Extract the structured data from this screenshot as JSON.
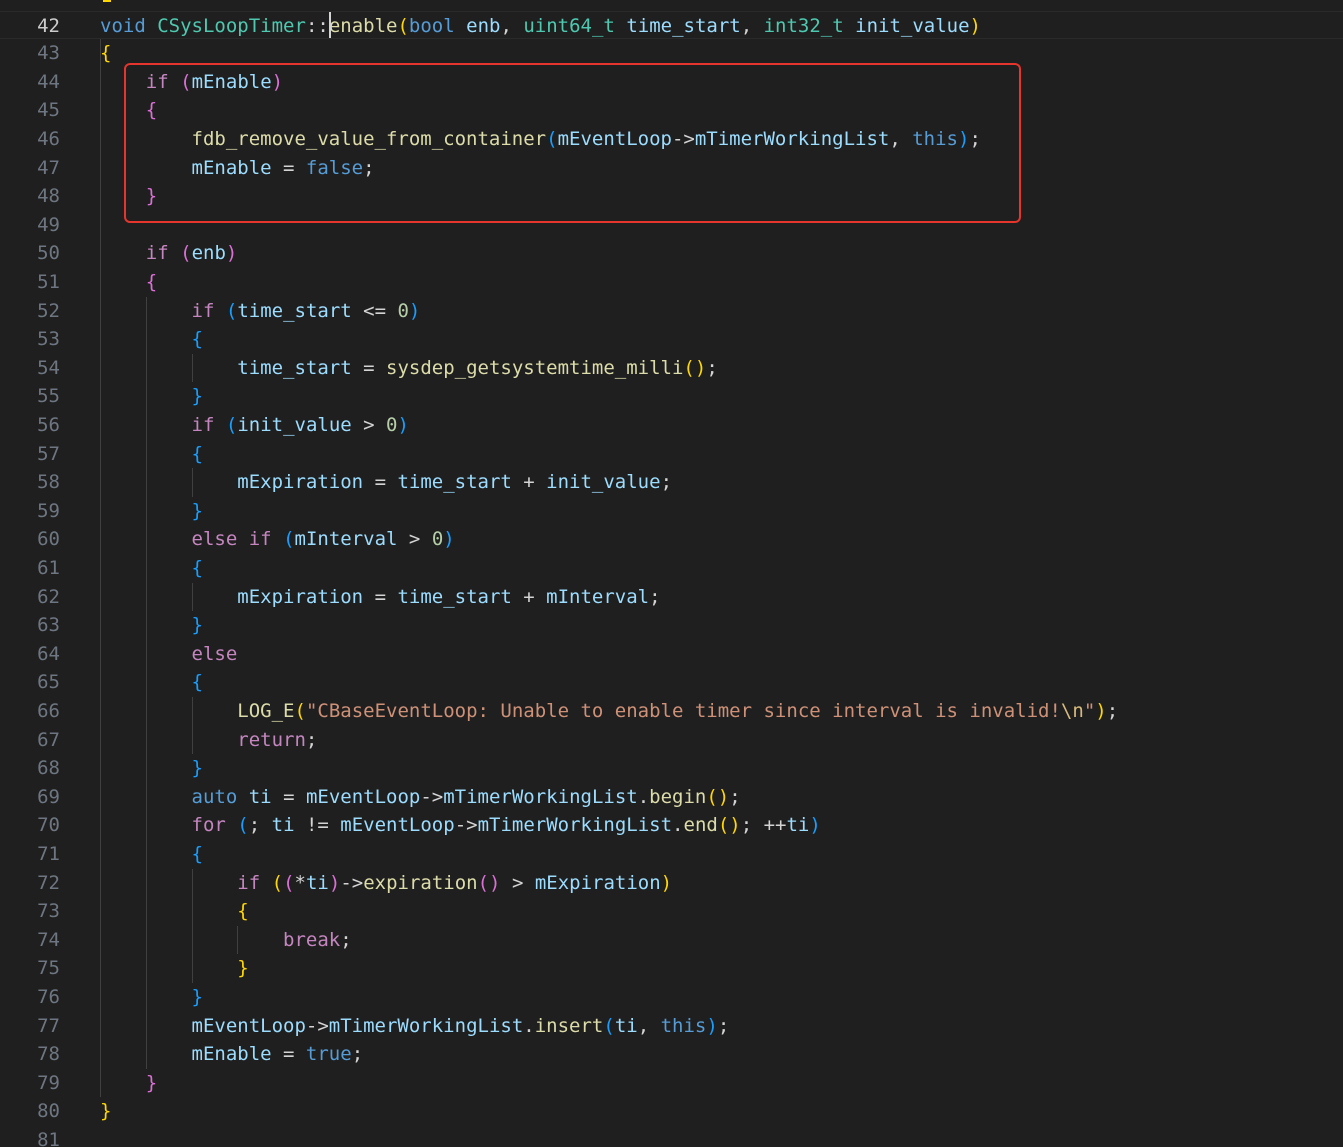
{
  "editor": {
    "theme_colors": {
      "background": "#1f1f1f",
      "line_number": "#6e7681",
      "active_line_number": "#cccccc",
      "keyword_blue": "#569cd6",
      "control_purple": "#c586c0",
      "type_teal": "#4ec9b0",
      "function_yellow": "#dcdcaa",
      "variable_blue": "#9cdcfe",
      "string_orange": "#ce9178",
      "number_green": "#b5cea8",
      "bracket_gold": "#ffd700",
      "bracket_pink": "#da70d6",
      "bracket_blue": "#179fff",
      "highlight_box": "#e5352c"
    },
    "current_line": 42,
    "lines": [
      {
        "n": "42",
        "tokens": [
          [
            "kw",
            "void"
          ],
          [
            "p",
            " "
          ],
          [
            "ty",
            "CSysLoopTimer"
          ],
          [
            "p",
            "::"
          ],
          [
            "fn",
            "enable"
          ],
          [
            "b1",
            "("
          ],
          [
            "kw",
            "bool"
          ],
          [
            "p",
            " "
          ],
          [
            "var",
            "enb"
          ],
          [
            "p",
            ", "
          ],
          [
            "ty",
            "uint64_t"
          ],
          [
            "p",
            " "
          ],
          [
            "var",
            "time_start"
          ],
          [
            "p",
            ", "
          ],
          [
            "ty",
            "int32_t"
          ],
          [
            "p",
            " "
          ],
          [
            "var",
            "init_value"
          ],
          [
            "b1",
            ")"
          ]
        ]
      },
      {
        "n": "43",
        "tokens": [
          [
            "b1",
            "{"
          ]
        ]
      },
      {
        "n": "44",
        "tokens": [
          [
            "p",
            "    "
          ],
          [
            "ctl",
            "if"
          ],
          [
            "p",
            " "
          ],
          [
            "b2",
            "("
          ],
          [
            "var",
            "mEnable"
          ],
          [
            "b2",
            ")"
          ]
        ]
      },
      {
        "n": "45",
        "tokens": [
          [
            "p",
            "    "
          ],
          [
            "b2",
            "{"
          ]
        ]
      },
      {
        "n": "46",
        "tokens": [
          [
            "p",
            "        "
          ],
          [
            "fn",
            "fdb_remove_value_from_container"
          ],
          [
            "b3",
            "("
          ],
          [
            "var",
            "mEventLoop"
          ],
          [
            "p",
            "->"
          ],
          [
            "var",
            "mTimerWorkingList"
          ],
          [
            "p",
            ", "
          ],
          [
            "kw",
            "this"
          ],
          [
            "b3",
            ")"
          ],
          [
            "p",
            ";"
          ]
        ]
      },
      {
        "n": "47",
        "tokens": [
          [
            "p",
            "        "
          ],
          [
            "var",
            "mEnable"
          ],
          [
            "p",
            " = "
          ],
          [
            "kw",
            "false"
          ],
          [
            "p",
            ";"
          ]
        ]
      },
      {
        "n": "48",
        "tokens": [
          [
            "p",
            "    "
          ],
          [
            "b2",
            "}"
          ]
        ]
      },
      {
        "n": "49",
        "tokens": []
      },
      {
        "n": "50",
        "tokens": [
          [
            "p",
            "    "
          ],
          [
            "ctl",
            "if"
          ],
          [
            "p",
            " "
          ],
          [
            "b2",
            "("
          ],
          [
            "var",
            "enb"
          ],
          [
            "b2",
            ")"
          ]
        ]
      },
      {
        "n": "51",
        "tokens": [
          [
            "p",
            "    "
          ],
          [
            "b2",
            "{"
          ]
        ]
      },
      {
        "n": "52",
        "tokens": [
          [
            "p",
            "        "
          ],
          [
            "ctl",
            "if"
          ],
          [
            "p",
            " "
          ],
          [
            "b3",
            "("
          ],
          [
            "var",
            "time_start"
          ],
          [
            "p",
            " <= "
          ],
          [
            "num",
            "0"
          ],
          [
            "b3",
            ")"
          ]
        ]
      },
      {
        "n": "53",
        "tokens": [
          [
            "p",
            "        "
          ],
          [
            "b3",
            "{"
          ]
        ]
      },
      {
        "n": "54",
        "tokens": [
          [
            "p",
            "            "
          ],
          [
            "var",
            "time_start"
          ],
          [
            "p",
            " = "
          ],
          [
            "fn",
            "sysdep_getsystemtime_milli"
          ],
          [
            "b1",
            "()"
          ],
          [
            "p",
            ";"
          ]
        ]
      },
      {
        "n": "55",
        "tokens": [
          [
            "p",
            "        "
          ],
          [
            "b3",
            "}"
          ]
        ]
      },
      {
        "n": "56",
        "tokens": [
          [
            "p",
            "        "
          ],
          [
            "ctl",
            "if"
          ],
          [
            "p",
            " "
          ],
          [
            "b3",
            "("
          ],
          [
            "var",
            "init_value"
          ],
          [
            "p",
            " > "
          ],
          [
            "num",
            "0"
          ],
          [
            "b3",
            ")"
          ]
        ]
      },
      {
        "n": "57",
        "tokens": [
          [
            "p",
            "        "
          ],
          [
            "b3",
            "{"
          ]
        ]
      },
      {
        "n": "58",
        "tokens": [
          [
            "p",
            "            "
          ],
          [
            "var",
            "mExpiration"
          ],
          [
            "p",
            " = "
          ],
          [
            "var",
            "time_start"
          ],
          [
            "p",
            " + "
          ],
          [
            "var",
            "init_value"
          ],
          [
            "p",
            ";"
          ]
        ]
      },
      {
        "n": "59",
        "tokens": [
          [
            "p",
            "        "
          ],
          [
            "b3",
            "}"
          ]
        ]
      },
      {
        "n": "60",
        "tokens": [
          [
            "p",
            "        "
          ],
          [
            "ctl",
            "else"
          ],
          [
            "p",
            " "
          ],
          [
            "ctl",
            "if"
          ],
          [
            "p",
            " "
          ],
          [
            "b3",
            "("
          ],
          [
            "var",
            "mInterval"
          ],
          [
            "p",
            " > "
          ],
          [
            "num",
            "0"
          ],
          [
            "b3",
            ")"
          ]
        ]
      },
      {
        "n": "61",
        "tokens": [
          [
            "p",
            "        "
          ],
          [
            "b3",
            "{"
          ]
        ]
      },
      {
        "n": "62",
        "tokens": [
          [
            "p",
            "            "
          ],
          [
            "var",
            "mExpiration"
          ],
          [
            "p",
            " = "
          ],
          [
            "var",
            "time_start"
          ],
          [
            "p",
            " + "
          ],
          [
            "var",
            "mInterval"
          ],
          [
            "p",
            ";"
          ]
        ]
      },
      {
        "n": "63",
        "tokens": [
          [
            "p",
            "        "
          ],
          [
            "b3",
            "}"
          ]
        ]
      },
      {
        "n": "64",
        "tokens": [
          [
            "p",
            "        "
          ],
          [
            "ctl",
            "else"
          ]
        ]
      },
      {
        "n": "65",
        "tokens": [
          [
            "p",
            "        "
          ],
          [
            "b3",
            "{"
          ]
        ]
      },
      {
        "n": "66",
        "tokens": [
          [
            "p",
            "            "
          ],
          [
            "fn",
            "LOG_E"
          ],
          [
            "b1",
            "("
          ],
          [
            "str",
            "\"CBaseEventLoop: Unable to enable timer since interval is invalid!"
          ],
          [
            "esc",
            "\\n"
          ],
          [
            "str",
            "\""
          ],
          [
            "b1",
            ")"
          ],
          [
            "p",
            ";"
          ]
        ]
      },
      {
        "n": "67",
        "tokens": [
          [
            "p",
            "            "
          ],
          [
            "ctl",
            "return"
          ],
          [
            "p",
            ";"
          ]
        ]
      },
      {
        "n": "68",
        "tokens": [
          [
            "p",
            "        "
          ],
          [
            "b3",
            "}"
          ]
        ]
      },
      {
        "n": "69",
        "tokens": [
          [
            "p",
            "        "
          ],
          [
            "kw",
            "auto"
          ],
          [
            "p",
            " "
          ],
          [
            "var",
            "ti"
          ],
          [
            "p",
            " = "
          ],
          [
            "var",
            "mEventLoop"
          ],
          [
            "p",
            "->"
          ],
          [
            "var",
            "mTimerWorkingList"
          ],
          [
            "p",
            "."
          ],
          [
            "fn",
            "begin"
          ],
          [
            "b1",
            "()"
          ],
          [
            "p",
            ";"
          ]
        ]
      },
      {
        "n": "70",
        "tokens": [
          [
            "p",
            "        "
          ],
          [
            "ctl",
            "for"
          ],
          [
            "p",
            " "
          ],
          [
            "b3",
            "("
          ],
          [
            "p",
            "; "
          ],
          [
            "var",
            "ti"
          ],
          [
            "p",
            " != "
          ],
          [
            "var",
            "mEventLoop"
          ],
          [
            "p",
            "->"
          ],
          [
            "var",
            "mTimerWorkingList"
          ],
          [
            "p",
            "."
          ],
          [
            "fn",
            "end"
          ],
          [
            "b1",
            "()"
          ],
          [
            "p",
            "; ++"
          ],
          [
            "var",
            "ti"
          ],
          [
            "b3",
            ")"
          ]
        ]
      },
      {
        "n": "71",
        "tokens": [
          [
            "p",
            "        "
          ],
          [
            "b3",
            "{"
          ]
        ]
      },
      {
        "n": "72",
        "tokens": [
          [
            "p",
            "            "
          ],
          [
            "ctl",
            "if"
          ],
          [
            "p",
            " "
          ],
          [
            "b1",
            "("
          ],
          [
            "b2",
            "("
          ],
          [
            "p",
            "*"
          ],
          [
            "var",
            "ti"
          ],
          [
            "b2",
            ")"
          ],
          [
            "p",
            "->"
          ],
          [
            "fn",
            "expiration"
          ],
          [
            "b2",
            "()"
          ],
          [
            "p",
            " > "
          ],
          [
            "var",
            "mExpiration"
          ],
          [
            "b1",
            ")"
          ]
        ]
      },
      {
        "n": "73",
        "tokens": [
          [
            "p",
            "            "
          ],
          [
            "b1",
            "{"
          ]
        ]
      },
      {
        "n": "74",
        "tokens": [
          [
            "p",
            "                "
          ],
          [
            "ctl",
            "break"
          ],
          [
            "p",
            ";"
          ]
        ]
      },
      {
        "n": "75",
        "tokens": [
          [
            "p",
            "            "
          ],
          [
            "b1",
            "}"
          ]
        ]
      },
      {
        "n": "76",
        "tokens": [
          [
            "p",
            "        "
          ],
          [
            "b3",
            "}"
          ]
        ]
      },
      {
        "n": "77",
        "tokens": [
          [
            "p",
            "        "
          ],
          [
            "var",
            "mEventLoop"
          ],
          [
            "p",
            "->"
          ],
          [
            "var",
            "mTimerWorkingList"
          ],
          [
            "p",
            "."
          ],
          [
            "fn",
            "insert"
          ],
          [
            "b3",
            "("
          ],
          [
            "var",
            "ti"
          ],
          [
            "p",
            ", "
          ],
          [
            "kw",
            "this"
          ],
          [
            "b3",
            ")"
          ],
          [
            "p",
            ";"
          ]
        ]
      },
      {
        "n": "78",
        "tokens": [
          [
            "p",
            "        "
          ],
          [
            "var",
            "mEnable"
          ],
          [
            "p",
            " = "
          ],
          [
            "kw",
            "true"
          ],
          [
            "p",
            ";"
          ]
        ]
      },
      {
        "n": "79",
        "tokens": [
          [
            "p",
            "    "
          ],
          [
            "b2",
            "}"
          ]
        ]
      },
      {
        "n": "80",
        "tokens": [
          [
            "b1",
            "}"
          ]
        ]
      },
      {
        "n": "81",
        "tokens": []
      }
    ]
  }
}
